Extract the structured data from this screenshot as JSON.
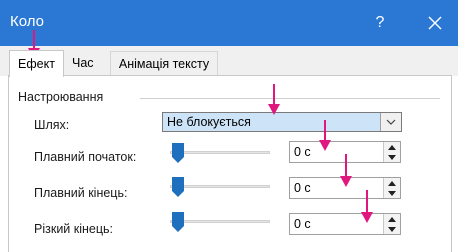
{
  "window": {
    "title": "Коло",
    "help": "?"
  },
  "tabs": [
    {
      "label": "Ефект",
      "active": true
    },
    {
      "label": "Час",
      "active": false
    },
    {
      "label": "Анімація тексту",
      "active": false
    }
  ],
  "settings": {
    "group_title": "Настроювання",
    "path_label": "Шлях:",
    "path_value": "Не блокується",
    "smooth_start_label": "Плавний початок:",
    "smooth_start_value": "0 с",
    "smooth_end_label": "Плавний кінець:",
    "smooth_end_value": "0 с",
    "sharp_end_label": "Різкий кінець:",
    "sharp_end_value": "0 с"
  },
  "colors": {
    "titlebar": "#2b78d4",
    "annotation_arrow": "#e0177f",
    "slider_thumb": "#1f6fbf"
  },
  "icons": {
    "help": "question-mark-icon",
    "close": "close-icon",
    "dropdown": "chevron-down-icon",
    "spin_up": "triangle-up-icon",
    "spin_down": "triangle-down-icon",
    "annotation": "down-arrow-icon"
  }
}
